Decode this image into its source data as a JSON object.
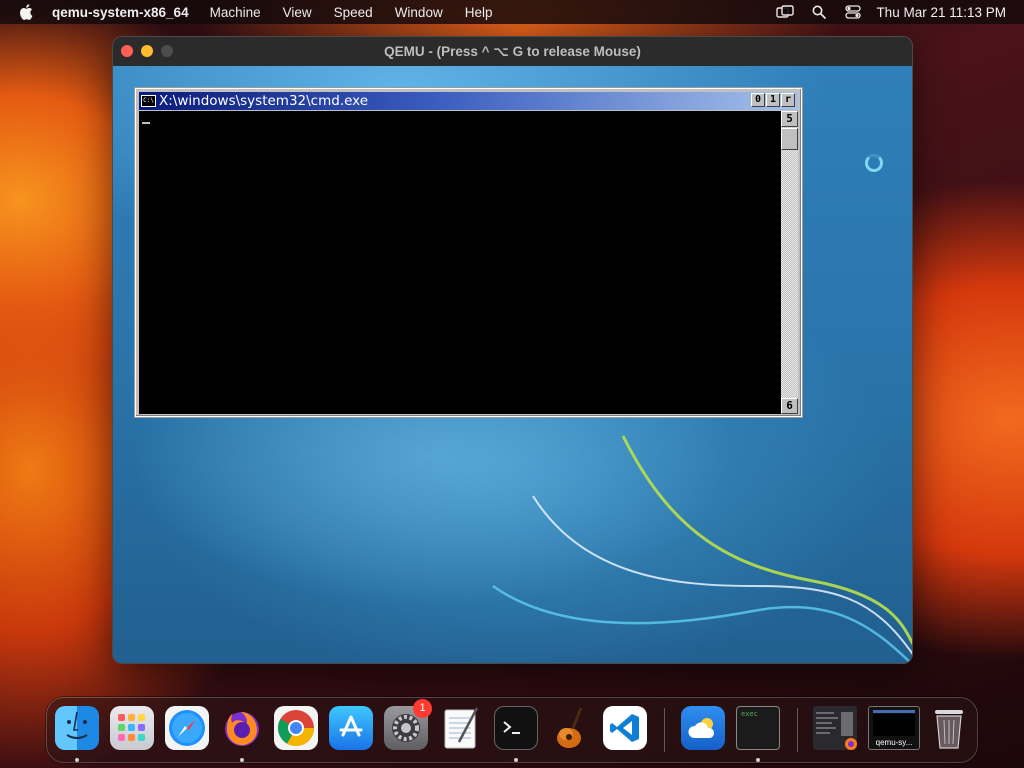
{
  "menubar": {
    "app_name": "qemu-system-x86_64",
    "items": [
      "Machine",
      "View",
      "Speed",
      "Window",
      "Help"
    ],
    "clock": "Thu Mar 21  11:13 PM",
    "status_icons": [
      "screen-mirroring-icon",
      "spotlight-search-icon",
      "control-center-icon"
    ]
  },
  "qemu": {
    "title": "QEMU - (Press  ^ ⌥ G  to release Mouse)"
  },
  "cmd": {
    "title": "X:\\windows\\system32\\cmd.exe",
    "title_buttons": [
      "0",
      "1",
      "r"
    ],
    "scroll_up": "5",
    "scroll_down": "6"
  },
  "dock": {
    "items": [
      {
        "name": "Finder",
        "icon": "finder-icon",
        "running": true
      },
      {
        "name": "Launchpad",
        "icon": "launchpad-icon",
        "running": false
      },
      {
        "name": "Safari",
        "icon": "safari-icon",
        "running": false
      },
      {
        "name": "Firefox",
        "icon": "firefox-icon",
        "running": true
      },
      {
        "name": "Google Chrome",
        "icon": "chrome-icon",
        "running": false
      },
      {
        "name": "App Store",
        "icon": "app-store-icon",
        "running": false
      },
      {
        "name": "System Settings",
        "icon": "system-settings-icon",
        "running": false,
        "badge": "1"
      },
      {
        "name": "TextEdit",
        "icon": "textedit-icon",
        "running": false
      },
      {
        "name": "Terminal",
        "icon": "terminal-icon",
        "running": true
      },
      {
        "name": "GarageBand",
        "icon": "garageband-icon",
        "running": false
      },
      {
        "name": "Visual Studio Code",
        "icon": "vscode-icon",
        "running": false
      },
      {
        "name": "Weather",
        "icon": "weather-icon",
        "running": false
      },
      {
        "name": "exec",
        "icon": "exec-terminal-icon",
        "running": true
      },
      {
        "name": "minimized-window",
        "icon": "minimized-window-icon",
        "running": false
      },
      {
        "name": "qemu-sy...",
        "icon": "qemu-thumbnail-icon",
        "running": false
      },
      {
        "name": "Trash",
        "icon": "trash-icon",
        "running": false
      }
    ],
    "exec_label": "exec",
    "qemu_thumb_label": "qemu-sy...",
    "colors": {
      "badge": "#ff3b30",
      "vscode": "#0e7fd6",
      "terminal": "#111111"
    }
  }
}
